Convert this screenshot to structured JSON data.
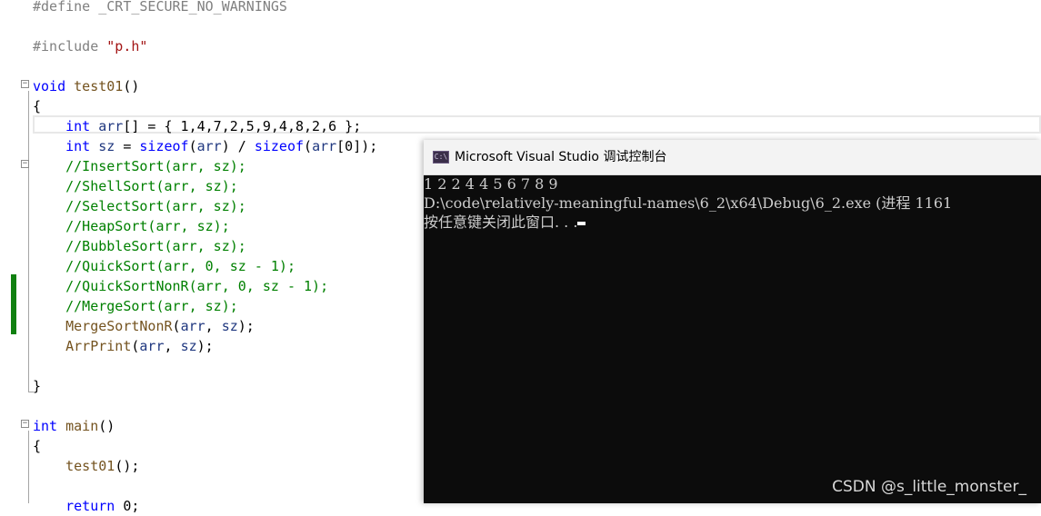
{
  "editor": {
    "lines": [
      {
        "parts": [
          {
            "t": "#define _CRT_SECURE_NO_WARNINGS",
            "c": "pp"
          }
        ]
      },
      {
        "parts": []
      },
      {
        "parts": [
          {
            "t": "#include ",
            "c": "pp"
          },
          {
            "t": "\"p.h\"",
            "c": "str"
          }
        ]
      },
      {
        "parts": []
      },
      {
        "parts": [
          {
            "t": "void ",
            "c": "kw"
          },
          {
            "t": "test01",
            "c": "fn"
          },
          {
            "t": "()",
            "c": ""
          }
        ]
      },
      {
        "parts": [
          {
            "t": "{",
            "c": ""
          }
        ]
      },
      {
        "parts": [
          {
            "t": "    ",
            "c": ""
          },
          {
            "t": "int ",
            "c": "kw"
          },
          {
            "t": "arr",
            "c": "var"
          },
          {
            "t": "[] = { 1,4,7,2,5,9,4,8,2,6 };",
            "c": ""
          }
        ]
      },
      {
        "parts": [
          {
            "t": "    ",
            "c": ""
          },
          {
            "t": "int ",
            "c": "kw"
          },
          {
            "t": "sz",
            "c": "var"
          },
          {
            "t": " = ",
            "c": ""
          },
          {
            "t": "sizeof",
            "c": "kw"
          },
          {
            "t": "(",
            "c": ""
          },
          {
            "t": "arr",
            "c": "var"
          },
          {
            "t": ") / ",
            "c": ""
          },
          {
            "t": "sizeof",
            "c": "kw"
          },
          {
            "t": "(",
            "c": ""
          },
          {
            "t": "arr",
            "c": "var"
          },
          {
            "t": "[0]);",
            "c": ""
          }
        ]
      },
      {
        "parts": [
          {
            "t": "    ",
            "c": ""
          },
          {
            "t": "//InsertSort(arr, sz);",
            "c": "cm"
          }
        ]
      },
      {
        "parts": [
          {
            "t": "    ",
            "c": ""
          },
          {
            "t": "//ShellSort(arr, sz);",
            "c": "cm"
          }
        ]
      },
      {
        "parts": [
          {
            "t": "    ",
            "c": ""
          },
          {
            "t": "//SelectSort(arr, sz);",
            "c": "cm"
          }
        ]
      },
      {
        "parts": [
          {
            "t": "    ",
            "c": ""
          },
          {
            "t": "//HeapSort(arr, sz);",
            "c": "cm"
          }
        ]
      },
      {
        "parts": [
          {
            "t": "    ",
            "c": ""
          },
          {
            "t": "//BubbleSort(arr, sz);",
            "c": "cm"
          }
        ]
      },
      {
        "parts": [
          {
            "t": "    ",
            "c": ""
          },
          {
            "t": "//QuickSort(arr, 0, sz - 1);",
            "c": "cm"
          }
        ]
      },
      {
        "parts": [
          {
            "t": "    ",
            "c": ""
          },
          {
            "t": "//QuickSortNonR(arr, 0, sz - 1);",
            "c": "cm"
          }
        ]
      },
      {
        "parts": [
          {
            "t": "    ",
            "c": ""
          },
          {
            "t": "//MergeSort(arr, sz);",
            "c": "cm"
          }
        ]
      },
      {
        "parts": [
          {
            "t": "    ",
            "c": ""
          },
          {
            "t": "MergeSortNonR",
            "c": "fn"
          },
          {
            "t": "(",
            "c": ""
          },
          {
            "t": "arr",
            "c": "var"
          },
          {
            "t": ", ",
            "c": ""
          },
          {
            "t": "sz",
            "c": "var"
          },
          {
            "t": ");",
            "c": ""
          }
        ]
      },
      {
        "parts": [
          {
            "t": "    ",
            "c": ""
          },
          {
            "t": "ArrPrint",
            "c": "fn"
          },
          {
            "t": "(",
            "c": ""
          },
          {
            "t": "arr",
            "c": "var"
          },
          {
            "t": ", ",
            "c": ""
          },
          {
            "t": "sz",
            "c": "var"
          },
          {
            "t": ");",
            "c": ""
          }
        ]
      },
      {
        "parts": []
      },
      {
        "parts": [
          {
            "t": "}",
            "c": ""
          }
        ]
      },
      {
        "parts": []
      },
      {
        "parts": [
          {
            "t": "int ",
            "c": "kw"
          },
          {
            "t": "main",
            "c": "fn"
          },
          {
            "t": "()",
            "c": ""
          }
        ]
      },
      {
        "parts": [
          {
            "t": "{",
            "c": ""
          }
        ]
      },
      {
        "parts": [
          {
            "t": "    ",
            "c": ""
          },
          {
            "t": "test01",
            "c": "fn"
          },
          {
            "t": "();",
            "c": ""
          }
        ]
      },
      {
        "parts": []
      },
      {
        "parts": [
          {
            "t": "    ",
            "c": ""
          },
          {
            "t": "return ",
            "c": "kw"
          },
          {
            "t": "0;",
            "c": ""
          }
        ]
      }
    ]
  },
  "console": {
    "title": "Microsoft Visual Studio 调试控制台",
    "icon_label": "C:\\",
    "output": [
      "1 2 2 4 4 5 6 7 8 9",
      "D:\\code\\relatively-meaningful-names\\6_2\\x64\\Debug\\6_2.exe (进程 1161",
      "按任意键关闭此窗口. . ."
    ]
  },
  "watermark": "CSDN @s_little_monster_"
}
